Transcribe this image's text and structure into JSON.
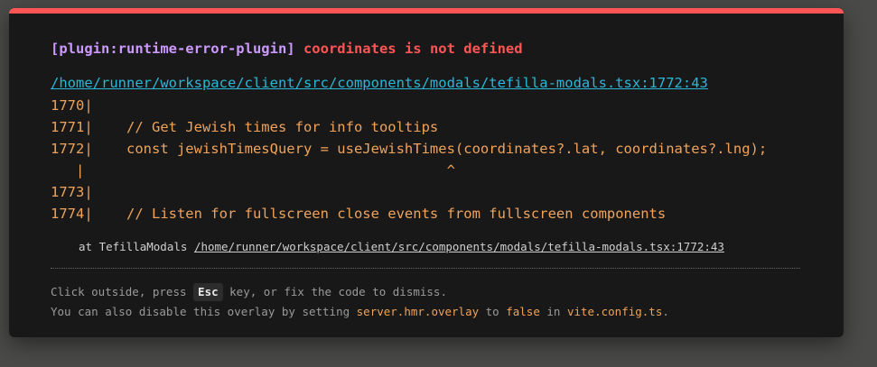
{
  "error": {
    "plugin": "[plugin:runtime-error-plugin]",
    "message": "coordinates is not defined",
    "file": "/home/runner/workspace/client/src/components/modals/tefilla-modals.tsx:1772:43"
  },
  "code_frame": [
    "1770|",
    "1771|    // Get Jewish times for info tooltips",
    "1772|    const jewishTimesQuery = useJewishTimes(coordinates?.lat, coordinates?.lng);",
    "   |                                           ^",
    "1773|",
    "1774|    // Listen for fullscreen close events from fullscreen components"
  ],
  "stack": {
    "prefix": "at TefillaModals",
    "path": "/home/runner/workspace/client/src/components/modals/tefilla-modals.tsx:1772:43"
  },
  "tips": {
    "line1_before": "Click outside, press ",
    "key": "Esc",
    "line1_after": " key, or fix the code to dismiss.",
    "line2_before": "You can also disable this overlay by setting ",
    "setting": "server.hmr.overlay",
    "line2_mid": " to ",
    "value": "false",
    "line2_in": " in ",
    "config_file": "vite.config.ts",
    "line2_end": "."
  },
  "colors": {
    "accent": "#ff5555",
    "plugin": "#cc99ff",
    "link": "#2ab7d8",
    "code": "#f0a35a"
  }
}
